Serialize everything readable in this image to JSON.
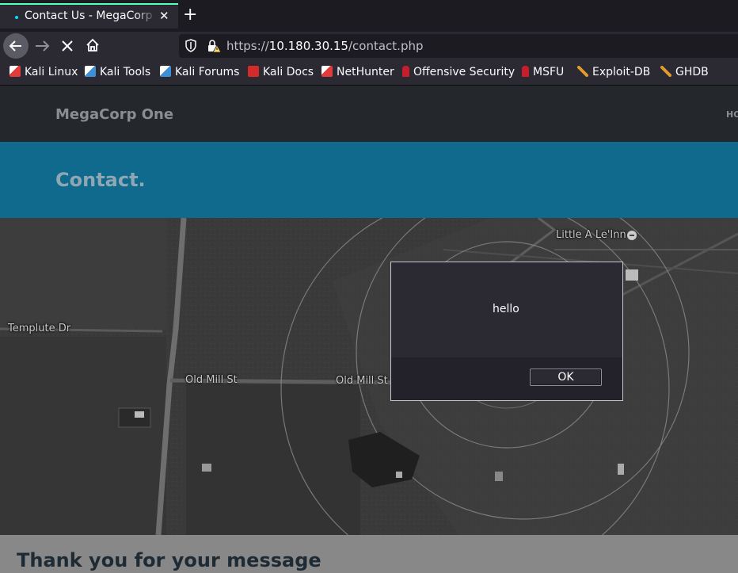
{
  "browser": {
    "tab": {
      "title": "Contact Us - MegaCorp One",
      "close_icon": "✕"
    },
    "new_tab_icon": "+",
    "url": {
      "protocol": "https://",
      "host": "10.180.30.15",
      "path": "/contact.php"
    },
    "bookmarks": [
      {
        "label": "Kali Linux",
        "icon": "kali-dragon-icon",
        "color": "#e23b3b"
      },
      {
        "label": "Kali Tools",
        "icon": "kali-tools-icon",
        "color": "#3d8fd6"
      },
      {
        "label": "Kali Forums",
        "icon": "kali-forums-icon",
        "color": "#3d8fd6"
      },
      {
        "label": "Kali Docs",
        "icon": "kali-docs-icon",
        "color": "#d42a2a"
      },
      {
        "label": "NetHunter",
        "icon": "nethunter-icon",
        "color": "#e23b3b"
      },
      {
        "label": "Offensive Security",
        "icon": "offsec-icon",
        "color": "#c81e2c"
      },
      {
        "label": "MSFU",
        "icon": "msfu-icon",
        "color": "#c81e2c"
      },
      {
        "label": "Exploit-DB",
        "icon": "exploit-db-icon",
        "color": "#e39a2c"
      },
      {
        "label": "GHDB",
        "icon": "ghdb-icon",
        "color": "#e39a2c"
      }
    ]
  },
  "site": {
    "brand": "MegaCorp One",
    "nav_partial": "HO",
    "page_title": "Contact.",
    "map_labels": {
      "poi": "Little A Le'Inn",
      "road1": "Templute Dr",
      "road2": "Old Mill St",
      "road3": "Old Mill St"
    },
    "message": "Thank you for your message"
  },
  "dialog": {
    "message": "hello",
    "ok_label": "OK"
  },
  "colors": {
    "tab_accent": "#54ffbd",
    "header_band": "#0f6a8e",
    "site_nav": "#24282c"
  }
}
